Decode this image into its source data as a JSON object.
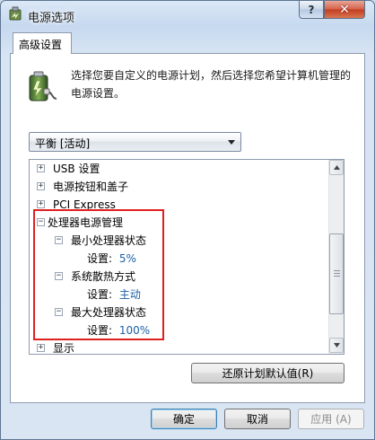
{
  "window": {
    "title": "电源选项",
    "help_label": "?",
    "close_label": "✕"
  },
  "tab": {
    "label": "高级设置"
  },
  "description": "选择您要自定义的电源计划，然后选择您希望计算机管理的电源设置。",
  "plan_select": {
    "value": "平衡 [活动]"
  },
  "tree": [
    {
      "label": "USB 设置",
      "expander": "+",
      "level": 0
    },
    {
      "label": "电源按钮和盖子",
      "expander": "+",
      "level": 0
    },
    {
      "label": "PCI Express",
      "expander": "+",
      "level": 0
    },
    {
      "label": "处理器电源管理",
      "expander": "−",
      "level": 0
    },
    {
      "label": "最小处理器状态",
      "expander": "−",
      "level": 1
    },
    {
      "label": "设置:",
      "value": "5%",
      "level": 2
    },
    {
      "label": "系统散热方式",
      "expander": "−",
      "level": 1
    },
    {
      "label": "设置:",
      "value": "主动",
      "level": 2
    },
    {
      "label": "最大处理器状态",
      "expander": "−",
      "level": 1
    },
    {
      "label": "设置:",
      "value": "100%",
      "level": 2
    },
    {
      "label": "显示",
      "expander": "+",
      "level": 0
    }
  ],
  "buttons": {
    "restore": "还原计划默认值(R)",
    "ok": "确定",
    "cancel": "取消",
    "apply": "应用 (A)"
  },
  "colors": {
    "value_text": "#1c5fa8",
    "highlight_box": "#e02020"
  }
}
